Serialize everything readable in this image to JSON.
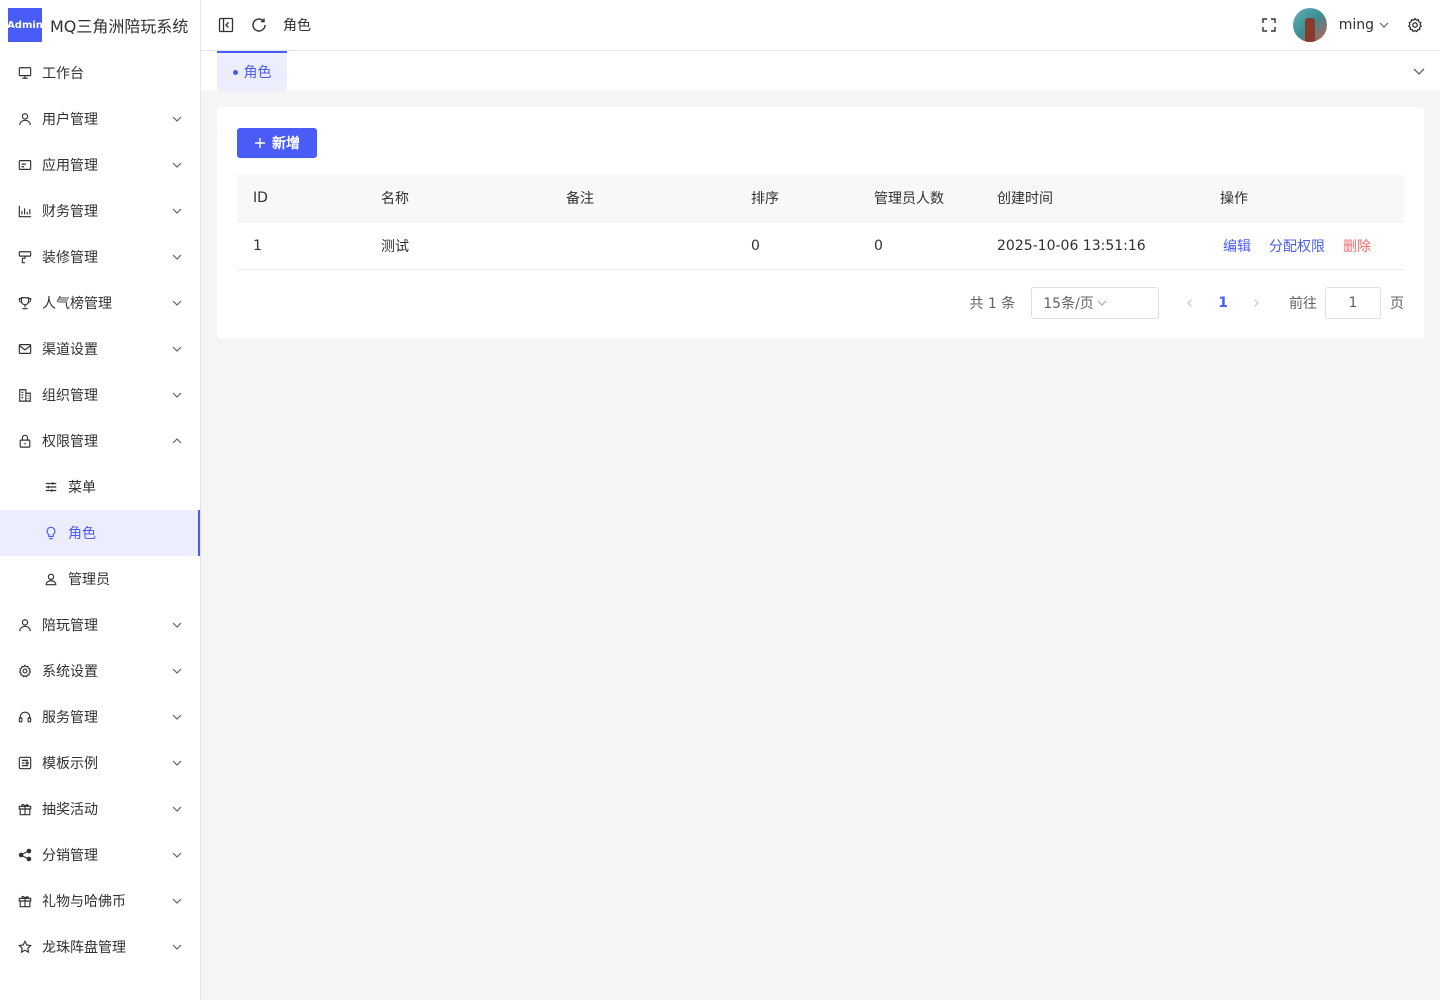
{
  "app": {
    "logo_badge": "Admin",
    "title": "MQ三角洲陪玩系统"
  },
  "sidebar": {
    "items": [
      {
        "label": "工作台",
        "icon": "monitor-icon",
        "expandable": false
      },
      {
        "label": "用户管理",
        "icon": "user-icon",
        "expandable": true
      },
      {
        "label": "应用管理",
        "icon": "app-card-icon",
        "expandable": true
      },
      {
        "label": "财务管理",
        "icon": "bar-chart-icon",
        "expandable": true
      },
      {
        "label": "装修管理",
        "icon": "brush-icon",
        "expandable": true
      },
      {
        "label": "人气榜管理",
        "icon": "trophy-icon",
        "expandable": true
      },
      {
        "label": "渠道设置",
        "icon": "mail-icon",
        "expandable": true
      },
      {
        "label": "组织管理",
        "icon": "building-icon",
        "expandable": true
      },
      {
        "label": "权限管理",
        "icon": "lock-icon",
        "expandable": true,
        "expanded": true
      },
      {
        "label": "陪玩管理",
        "icon": "user-icon",
        "expandable": true
      },
      {
        "label": "系统设置",
        "icon": "gear-icon",
        "expandable": true
      },
      {
        "label": "服务管理",
        "icon": "headset-icon",
        "expandable": true
      },
      {
        "label": "模板示例",
        "icon": "template-icon",
        "expandable": true
      },
      {
        "label": "抽奖活动",
        "icon": "gift-icon",
        "expandable": true
      },
      {
        "label": "分销管理",
        "icon": "share-icon",
        "expandable": true
      },
      {
        "label": "礼物与哈佛币",
        "icon": "gift-icon",
        "expandable": true
      },
      {
        "label": "龙珠阵盘管理",
        "icon": "star-icon",
        "expandable": true
      }
    ],
    "permission_children": [
      {
        "label": "菜单",
        "icon": "sliders-icon"
      },
      {
        "label": "角色",
        "icon": "bulb-icon",
        "active": true
      },
      {
        "label": "管理员",
        "icon": "user-outline-icon"
      }
    ]
  },
  "header": {
    "breadcrumb": "角色",
    "username": "ming"
  },
  "tabs": [
    {
      "label": "角色",
      "active": true
    }
  ],
  "toolbar": {
    "add_label": "新增"
  },
  "table": {
    "columns": [
      "ID",
      "名称",
      "备注",
      "排序",
      "管理员人数",
      "创建时间",
      "操作"
    ],
    "rows": [
      {
        "id": "1",
        "name": "测试",
        "remark": "",
        "sort": "0",
        "admins": "0",
        "created": "2025-10-06 13:51:16"
      }
    ],
    "actions": {
      "edit": "编辑",
      "assign": "分配权限",
      "delete": "删除"
    }
  },
  "pagination": {
    "total": "共 1 条",
    "page_size": "15条/页",
    "current_page": "1",
    "goto_label": "前往",
    "goto_value": "1",
    "page_suffix": "页"
  },
  "colors": {
    "accent": "#4a5cf6",
    "danger": "#f56c6c",
    "active_bg": "#ecedfd"
  }
}
